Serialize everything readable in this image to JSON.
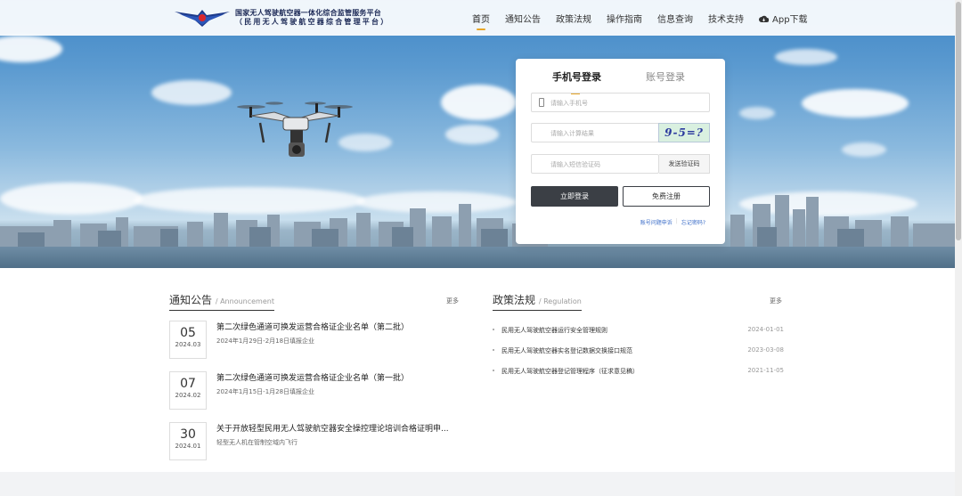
{
  "header": {
    "brand_line1": "国家无人驾驶航空器一体化综合监管服务平台",
    "brand_line2": "（民用无人驾驶航空器综合管理平台）",
    "menu": [
      {
        "label": "首页"
      },
      {
        "label": "通知公告"
      },
      {
        "label": "政策法规"
      },
      {
        "label": "操作指南"
      },
      {
        "label": "信息查询"
      },
      {
        "label": "技术支持"
      },
      {
        "label": "App下载"
      }
    ]
  },
  "login": {
    "tab_phone": "手机号登录",
    "tab_account": "账号登录",
    "phone_placeholder": "请输入手机号",
    "calc_placeholder": "请输入计算结果",
    "captcha_text": "9-5=?",
    "sms_placeholder": "请输入短信验证码",
    "sms_button": "发送验证码",
    "login_button": "立即登录",
    "register_button": "免费注册",
    "appeal_link": "账号问题申诉",
    "forgot_link": "忘记密码?"
  },
  "notices": {
    "title": "通知公告",
    "title_en": "/ Announcement",
    "more": "更多",
    "items": [
      {
        "day": "05",
        "ym": "2024.03",
        "title": "第二次绿色通道可换发运营合格证企业名单（第二批）",
        "sub": "2024年1月29日-2月18日填报企业"
      },
      {
        "day": "07",
        "ym": "2024.02",
        "title": "第二次绿色通道可换发运营合格证企业名单（第一批）",
        "sub": "2024年1月15日-1月28日填报企业"
      },
      {
        "day": "30",
        "ym": "2024.01",
        "title": "关于开放轻型民用无人驾驶航空器安全操控理论培训合格证明申...",
        "sub": "轻型无人机在管制空域内飞行"
      }
    ]
  },
  "policies": {
    "title": "政策法规",
    "title_en": "/ Regulation",
    "more": "更多",
    "items": [
      {
        "title": "民用无人驾驶航空器运行安全管理规则",
        "date": "2024-01-01"
      },
      {
        "title": "民用无人驾驶航空器实名登记数据交换接口规范",
        "date": "2023-03-08"
      },
      {
        "title": "民用无人驾驶航空器登记管理程序（征求意见稿）",
        "date": "2021-11-05"
      }
    ]
  },
  "colors": {
    "accent": "#e8a628",
    "brand_navy": "#1d2a57",
    "button_dark": "#3b3f45",
    "link_blue": "#3a6cc8"
  }
}
